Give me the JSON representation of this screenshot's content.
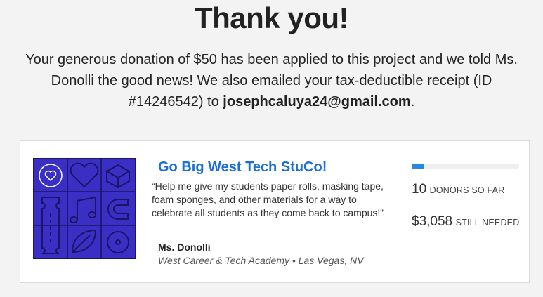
{
  "page": {
    "title": "Thank you!",
    "message": {
      "part1": "Your generous donation of $50 has been applied to this project and we told Ms. Donolli the good news! We also emailed your tax-deductible receipt (ID #14246542) to ",
      "email": "josephcaluya24@gmail.com",
      "part2": "."
    }
  },
  "project": {
    "title": "Go Big West Tech StuCo!",
    "quote": "“Help me give my students paper rolls, masking tape, foam sponges, and other materials for a way to celebrate all students as they come back to campus!”",
    "teacher": "Ms. Donolli",
    "school": "West Career & Tech Academy • Las Vegas, NV",
    "artwork_icons": [
      "heart-icon",
      "box-icon",
      "ticket-icon",
      "music-note-icon",
      "magnet-icon",
      "leaf-icon",
      "record-icon"
    ],
    "progress_fraction": 0.12,
    "donors_count": "10",
    "donors_label": "DONORS SO FAR",
    "needed_amount": "$3,058",
    "needed_label": "STILL NEEDED"
  },
  "colors": {
    "accent_link": "#1b6fd8",
    "artwork_bg": "#3a2fc4",
    "progress_fill": "#2a86e3"
  }
}
